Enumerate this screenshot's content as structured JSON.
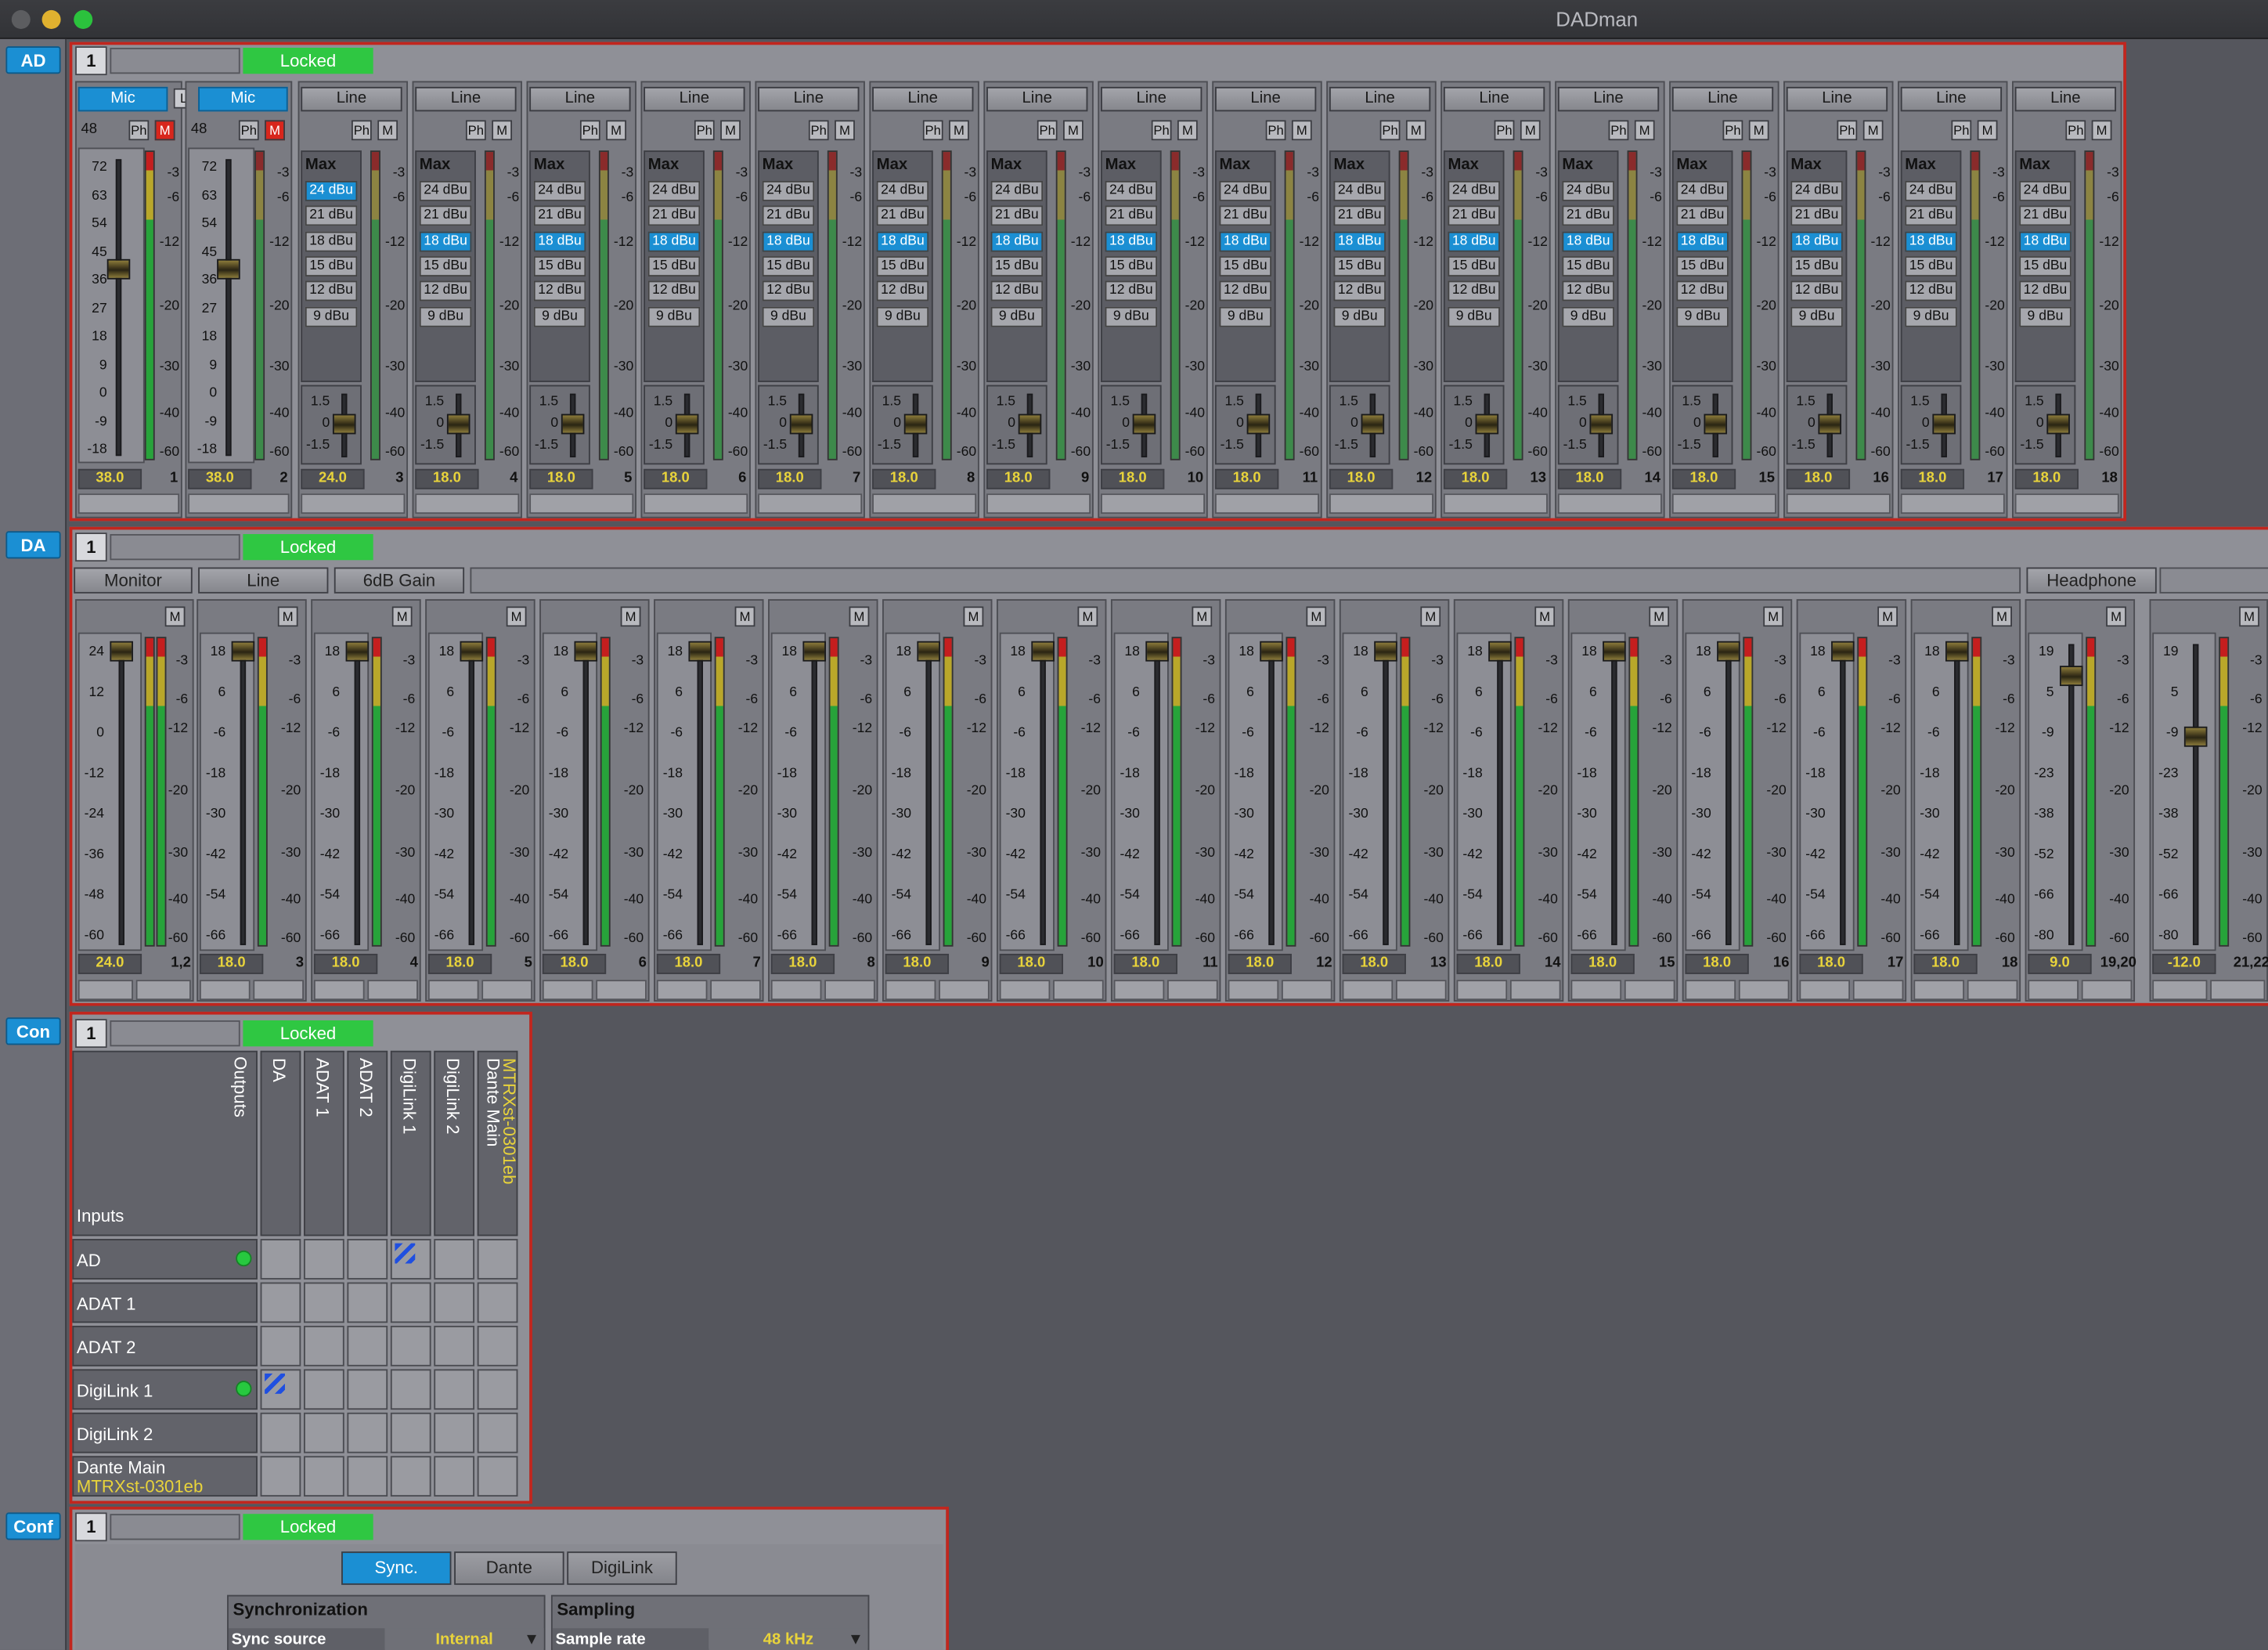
{
  "window": {
    "title": "DADman"
  },
  "nav": {
    "ad": "AD",
    "da": "DA",
    "con": "Con",
    "conf": "Conf"
  },
  "device": {
    "number": "1",
    "status": "Locked"
  },
  "ad": {
    "mic_label": "Mic",
    "link_label": "L",
    "phantom_label": "Ph",
    "mute_label": "M",
    "p48_label": "48",
    "line_label": "Line",
    "max_label": "Max",
    "ref_levels": [
      "24 dBu",
      "21 dBu",
      "18 dBu",
      "15 dBu",
      "12 dBu",
      "9 dBu"
    ],
    "mic_scale": [
      "72",
      "63",
      "54",
      "45",
      "36",
      "27",
      "18",
      "9",
      "0",
      "-9",
      "-18"
    ],
    "meter_scale": [
      "-3",
      "-6",
      "-12",
      "-20",
      "-30",
      "-40",
      "-60"
    ],
    "trim_scale": [
      "1.5",
      "0",
      "-1.5"
    ],
    "channels": [
      {
        "num": "1",
        "value": "38.0",
        "type": "mic",
        "level": "36"
      },
      {
        "num": "2",
        "value": "38.0",
        "type": "mic",
        "level": "36"
      },
      {
        "num": "3",
        "value": "24.0",
        "type": "line",
        "sel": 0
      },
      {
        "num": "4",
        "value": "18.0",
        "type": "line",
        "sel": 2
      },
      {
        "num": "5",
        "value": "18.0",
        "type": "line",
        "sel": 2
      },
      {
        "num": "6",
        "value": "18.0",
        "type": "line",
        "sel": 2
      },
      {
        "num": "7",
        "value": "18.0",
        "type": "line",
        "sel": 2
      },
      {
        "num": "8",
        "value": "18.0",
        "type": "line",
        "sel": 2
      },
      {
        "num": "9",
        "value": "18.0",
        "type": "line",
        "sel": 2
      },
      {
        "num": "10",
        "value": "18.0",
        "type": "line",
        "sel": 2
      },
      {
        "num": "11",
        "value": "18.0",
        "type": "line",
        "sel": 2
      },
      {
        "num": "12",
        "value": "18.0",
        "type": "line",
        "sel": 2
      },
      {
        "num": "13",
        "value": "18.0",
        "type": "line",
        "sel": 2
      },
      {
        "num": "14",
        "value": "18.0",
        "type": "line",
        "sel": 2
      },
      {
        "num": "15",
        "value": "18.0",
        "type": "line",
        "sel": 2
      },
      {
        "num": "16",
        "value": "18.0",
        "type": "line",
        "sel": 2
      },
      {
        "num": "17",
        "value": "18.0",
        "type": "line",
        "sel": 2
      },
      {
        "num": "18",
        "value": "18.0",
        "type": "line",
        "sel": 2
      }
    ]
  },
  "da": {
    "categories": [
      "Monitor",
      "Line",
      "6dB Gain"
    ],
    "headphone": "Headphone",
    "mute_label": "M",
    "meter_scale": [
      "-3",
      "-6",
      "-12",
      "-20",
      "-30",
      "-40",
      "-60"
    ],
    "scale_first": [
      "24",
      "12",
      "0",
      "-12",
      "-24",
      "-36",
      "-48",
      "-60"
    ],
    "scale_line": [
      "18",
      "6",
      "-6",
      "-18",
      "-30",
      "-42",
      "-54",
      "-66"
    ],
    "scale_hp": [
      "19",
      "5",
      "-9",
      "-23",
      "-38",
      "-52",
      "-66",
      "-80"
    ],
    "channels": [
      {
        "num": "1,2",
        "value": "24.0"
      },
      {
        "num": "3",
        "value": "18.0"
      },
      {
        "num": "4",
        "value": "18.0"
      },
      {
        "num": "5",
        "value": "18.0"
      },
      {
        "num": "6",
        "value": "18.0"
      },
      {
        "num": "7",
        "value": "18.0"
      },
      {
        "num": "8",
        "value": "18.0"
      },
      {
        "num": "9",
        "value": "18.0"
      },
      {
        "num": "10",
        "value": "18.0"
      },
      {
        "num": "11",
        "value": "18.0"
      },
      {
        "num": "12",
        "value": "18.0"
      },
      {
        "num": "13",
        "value": "18.0"
      },
      {
        "num": "14",
        "value": "18.0"
      },
      {
        "num": "15",
        "value": "18.0"
      },
      {
        "num": "16",
        "value": "18.0"
      },
      {
        "num": "17",
        "value": "18.0"
      },
      {
        "num": "18",
        "value": "18.0"
      },
      {
        "num": "19,20",
        "value": "9.0"
      },
      {
        "num": "21,22",
        "value": "-12.0"
      }
    ]
  },
  "matrix": {
    "outputs_label": "Outputs",
    "inputs_label": "Inputs",
    "columns": [
      "DA",
      "ADAT 1",
      "ADAT 2",
      "DigiLink 1",
      "DigiLink 2"
    ],
    "dante_col": {
      "name": "Dante Main",
      "device": "MTRXst-0301eb"
    },
    "rows": [
      "AD",
      "ADAT 1",
      "ADAT 2",
      "DigiLink 1",
      "DigiLink 2"
    ],
    "dante_row": {
      "name": "Dante Main",
      "device": "MTRXst-0301eb"
    }
  },
  "conf": {
    "tabs": [
      "Sync.",
      "Dante",
      "DigiLink"
    ],
    "sync": {
      "title": "Synchronization",
      "label": "Sync source",
      "value": "Internal"
    },
    "sampling": {
      "title": "Sampling",
      "label": "Sample rate",
      "value": "48 kHz"
    }
  }
}
